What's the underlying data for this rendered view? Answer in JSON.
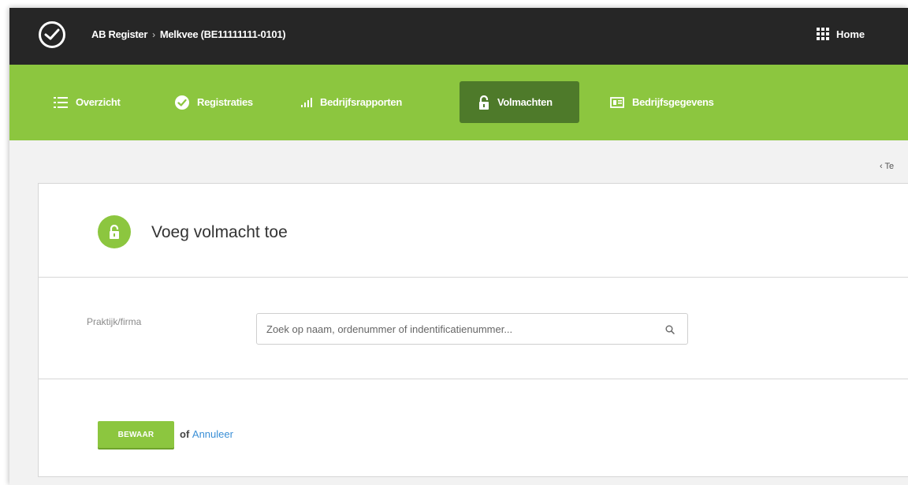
{
  "header": {
    "breadcrumb_root": "AB Register",
    "breadcrumb_current": "Melkvee (BE11111111-0101)",
    "breadcrumb_separator": "›",
    "home_label": "Home"
  },
  "nav": {
    "items": [
      {
        "label": "Overzicht",
        "icon": "list-icon"
      },
      {
        "label": "Registraties",
        "icon": "check-circle-icon"
      },
      {
        "label": "Bedrijfsrapporten",
        "icon": "bar-chart-icon"
      },
      {
        "label": "Volmachten",
        "icon": "lock-icon",
        "active": true
      },
      {
        "label": "Bedrijfsgegevens",
        "icon": "id-card-icon"
      }
    ]
  },
  "back_link": {
    "label": "Te"
  },
  "form": {
    "title": "Voeg volmacht toe",
    "field_label": "Praktijk/firma",
    "search_placeholder": "Zoek op naam, ordenummer of indentificatienummer...",
    "search_value": "",
    "save_label": "BEWAAR",
    "or_text": "of",
    "cancel_label": "Annuleer"
  },
  "colors": {
    "topbar": "#262626",
    "nav_green": "#8cc63f",
    "nav_active": "#4e7a2a",
    "link_blue": "#3a8fd6"
  }
}
